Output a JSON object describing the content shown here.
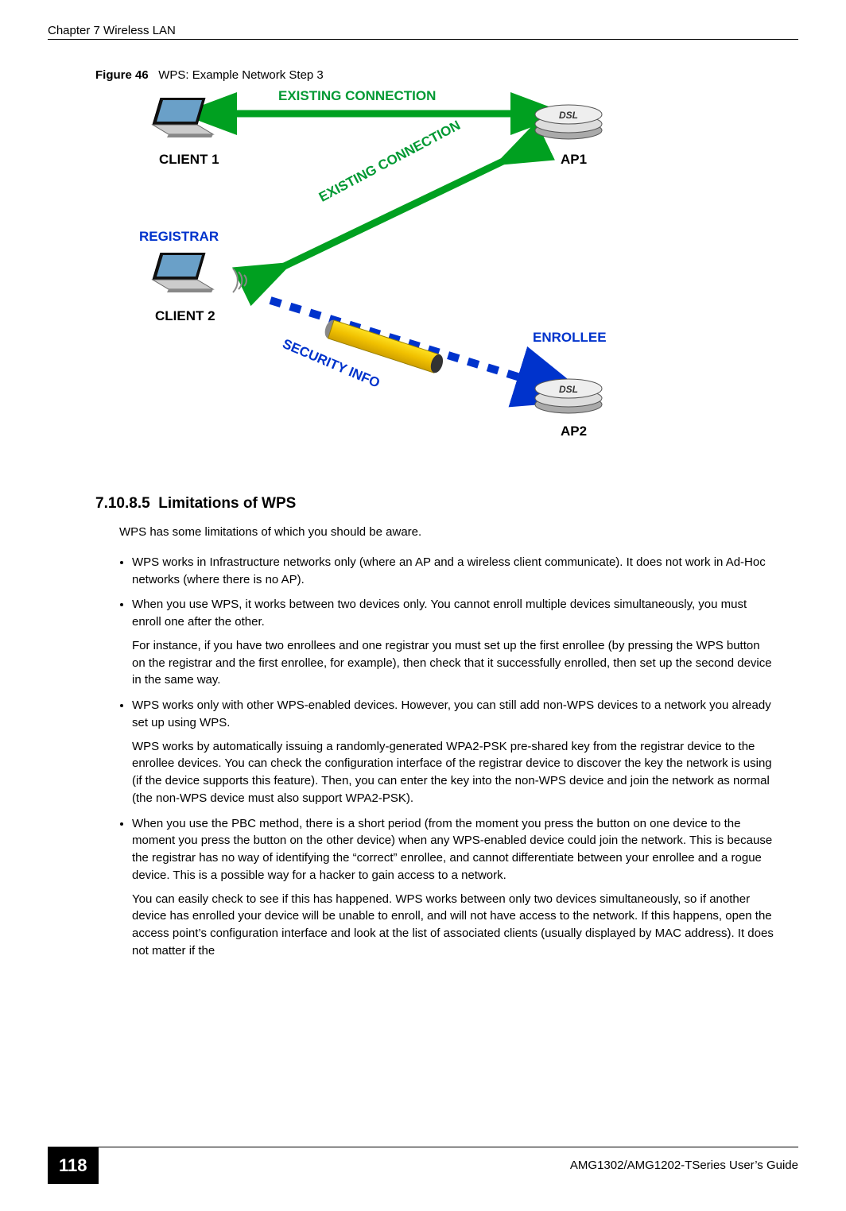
{
  "header": {
    "chapter": "Chapter 7 Wireless LAN"
  },
  "figure": {
    "label": "Figure 46",
    "title": "WPS: Example Network Step 3"
  },
  "diagram": {
    "existing_connection": "EXISTING CONNECTION",
    "existing_connection2": "EXISTING CONNECTION",
    "client1": "CLIENT 1",
    "ap1": "AP1",
    "registrar": "REGISTRAR",
    "client2": "CLIENT 2",
    "enrollee": "ENROLLEE",
    "security_info": "SECURITY INFO",
    "ap2": "AP2"
  },
  "section": {
    "number": "7.10.8.5",
    "title": "Limitations of WPS"
  },
  "body": {
    "intro": "WPS has some limitations of which you should be aware.",
    "bullets": [
      {
        "main": "WPS works in Infrastructure networks only (where an AP and a wireless client communicate). It does not work in Ad-Hoc networks (where there is no AP)."
      },
      {
        "main": "When you use WPS, it works between two devices only. You cannot enroll multiple devices simultaneously, you must enroll one after the other.",
        "sub": "For instance, if you have two enrollees and one registrar you must set up the first enrollee (by pressing the WPS button on the registrar and the first enrollee, for example), then check that it successfully enrolled, then set up the second device in the same way."
      },
      {
        "main": "WPS works only with other WPS-enabled devices. However, you can still add non-WPS devices to a network you already set up using WPS.",
        "sub": "WPS works by automatically issuing a randomly-generated WPA2-PSK pre-shared key from the registrar device to the enrollee devices. You can check the configuration interface of the registrar device to discover the key the network is using (if the device supports this feature). Then, you can enter the key into the non-WPS device and join the network as normal (the non-WPS device must also support WPA2-PSK)."
      },
      {
        "main": "When you use the PBC method, there is a short period (from the moment you press the button on one device to the moment you press the button on the other device) when any WPS-enabled device could join the network. This is because the registrar has no way of identifying the “correct” enrollee, and cannot differentiate between your enrollee and a rogue device. This is a possible way for a hacker to gain access to a network.",
        "sub": "You can easily check to see if this has happened. WPS works between only two devices simultaneously, so if another device has enrolled your device will be unable to enroll, and will not have access to the network. If this happens, open the access point’s configuration interface and look at the list of associated clients (usually displayed by MAC address). It does not matter if the"
      }
    ]
  },
  "footer": {
    "page": "118",
    "doc": "AMG1302/AMG1202-TSeries User’s Guide"
  }
}
